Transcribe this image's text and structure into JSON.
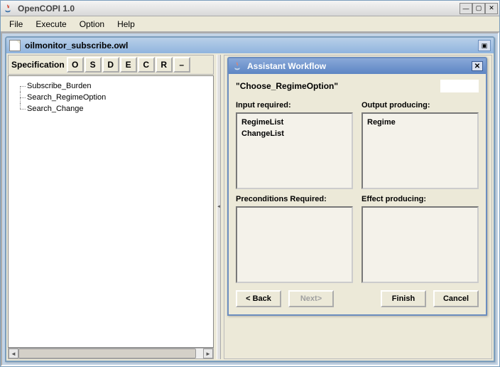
{
  "app": {
    "title": "OpenCOPI 1.0",
    "menus": [
      "File",
      "Execute",
      "Option",
      "Help"
    ]
  },
  "internal_frame": {
    "title": "oilmonitor_subscribe.owl"
  },
  "specbar": {
    "label": "Specification",
    "buttons": [
      "O",
      "S",
      "D",
      "E",
      "C",
      "R",
      "–"
    ]
  },
  "tree": {
    "items": [
      "Subscribe_Burden",
      "Search_RegimeOption",
      "Search_Change"
    ]
  },
  "dialog": {
    "title": "Assistant Workflow",
    "choose_name": "\"Choose_RegimeOption\"",
    "labels": {
      "input_required": "Input required:",
      "output_producing": "Output producing:",
      "precond_required": "Preconditions Required:",
      "effect_producing": "Effect producing:"
    },
    "inputs": [
      "RegimeList",
      "ChangeList"
    ],
    "outputs": [
      "Regime"
    ],
    "preconditions": [],
    "effects": [],
    "buttons": {
      "back": "< Back",
      "next": "Next>",
      "finish": "Finish",
      "cancel": "Cancel"
    }
  }
}
